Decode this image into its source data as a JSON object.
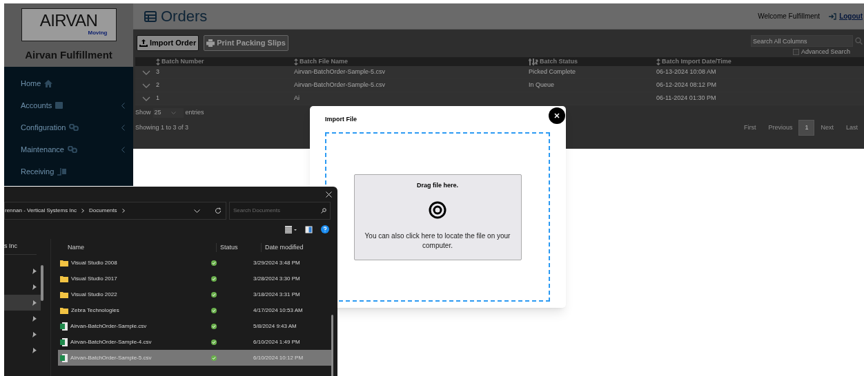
{
  "sidebar": {
    "logo": {
      "brand": "AIRVAN",
      "tagline": "Moving"
    },
    "title": "Airvan Fulfillment",
    "items": [
      {
        "label": "Home",
        "has_submenu": false
      },
      {
        "label": "Accounts",
        "has_submenu": true
      },
      {
        "label": "Configuration",
        "has_submenu": true
      },
      {
        "label": "Maintenance",
        "has_submenu": true
      },
      {
        "label": "Receiving",
        "has_submenu": false
      }
    ]
  },
  "header": {
    "title": "Orders",
    "welcome": "Welcome Fulfillment",
    "logout": "Logout"
  },
  "toolbar": [
    {
      "label": "Import Order",
      "disabled": false
    },
    {
      "label": "Print Packing Slips",
      "disabled": true
    }
  ],
  "search": {
    "placeholder": "Search All Columns",
    "advanced": {
      "label": "Advanced Search",
      "checked": false
    }
  },
  "table": {
    "columns": [
      {
        "label": "Batch Number"
      },
      {
        "label": "Batch File Name"
      },
      {
        "label": "Batch Status"
      },
      {
        "label": "Batch Import Date/Time"
      }
    ],
    "rows": [
      {
        "expanded": false,
        "cells": [
          "3",
          "Airvan-BatchOrder-Sample-5.csv",
          "Picked Complete",
          "06-13-2024 10:08 AM"
        ]
      },
      {
        "expanded": false,
        "cells": [
          "2",
          "Airvan-BatchOrder-Sample-5.csv",
          "In Queue",
          "06-12-2024 08:12 PM"
        ]
      },
      {
        "expanded": false,
        "cells": [
          "1",
          "Ai",
          "",
          "06-11-2024 01:30 PM"
        ]
      }
    ]
  },
  "length": {
    "before": "Show",
    "value": "25",
    "after": "entries"
  },
  "info": "Showing 1 to 3 of 3",
  "pagination": [
    {
      "label": "First",
      "selected": false
    },
    {
      "label": "Previous",
      "selected": false
    },
    {
      "label": "1",
      "selected": true
    },
    {
      "label": "Next",
      "selected": false
    },
    {
      "label": "Last",
      "selected": false
    }
  ],
  "modal": {
    "title": "Import File",
    "drop_heading": "Drag file here.",
    "drop_hint": "You can also click here to locate the file on your computer."
  },
  "file_dialog": {
    "breadcrumb": [
      "rennan - Vertical Systems Inc",
      "Documents"
    ],
    "search_placeholder": "Search Documents",
    "nav_label": "s Inc",
    "pins": [
      {
        "selected": false
      },
      {
        "selected": false
      },
      {
        "selected": true
      },
      {
        "selected": false
      },
      {
        "selected": false
      },
      {
        "selected": false
      }
    ],
    "columns": [
      "Name",
      "Status",
      "Date modified"
    ],
    "files": [
      {
        "kind": "folder",
        "name": "Visual Studio 2008",
        "date": "3/29/2024 3:48 PM",
        "selected": false
      },
      {
        "kind": "folder",
        "name": "Visual Studio 2017",
        "date": "3/28/2024 3:30 PM",
        "selected": false
      },
      {
        "kind": "folder",
        "name": "Visual Studio 2022",
        "date": "3/18/2024 3:31 PM",
        "selected": false
      },
      {
        "kind": "folder",
        "name": "Zebra Technologies",
        "date": "4/17/2024 10:53 AM",
        "selected": false
      },
      {
        "kind": "csv",
        "name": "Airvan-BatchOrder-Sample.csv",
        "date": "5/8/2024 9:43 AM",
        "selected": false
      },
      {
        "kind": "csv",
        "name": "Airvan-BatchOrder-Sample-4.csv",
        "date": "6/10/2024 1:49 PM",
        "selected": false
      },
      {
        "kind": "csv",
        "name": "Airvan-BatchOrder-Sample-5.csv",
        "date": "6/10/2024 10:12 PM",
        "selected": true
      }
    ]
  }
}
